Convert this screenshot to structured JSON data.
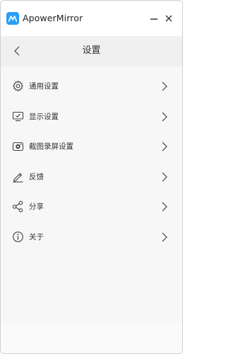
{
  "window": {
    "app_title": "ApowerMirror",
    "logo_icon": "apowermirror-logo-icon",
    "minimize_icon": "minimize-icon",
    "close_icon": "close-icon"
  },
  "header": {
    "back_icon": "chevron-left-icon",
    "title": "设置"
  },
  "menu": {
    "items": [
      {
        "label": "通用设置",
        "icon": "gear-icon"
      },
      {
        "label": "显示设置",
        "icon": "monitor-icon"
      },
      {
        "label": "截图录屏设置",
        "icon": "camera-icon"
      },
      {
        "label": "反馈",
        "icon": "pen-icon"
      },
      {
        "label": "分享",
        "icon": "share-icon"
      },
      {
        "label": "关于",
        "icon": "info-icon"
      }
    ],
    "chevron_icon": "chevron-right-icon"
  },
  "colors": {
    "accent": "#2a9df4",
    "header_bg": "#f0f0f0",
    "content_bg": "#f7f7f7"
  }
}
